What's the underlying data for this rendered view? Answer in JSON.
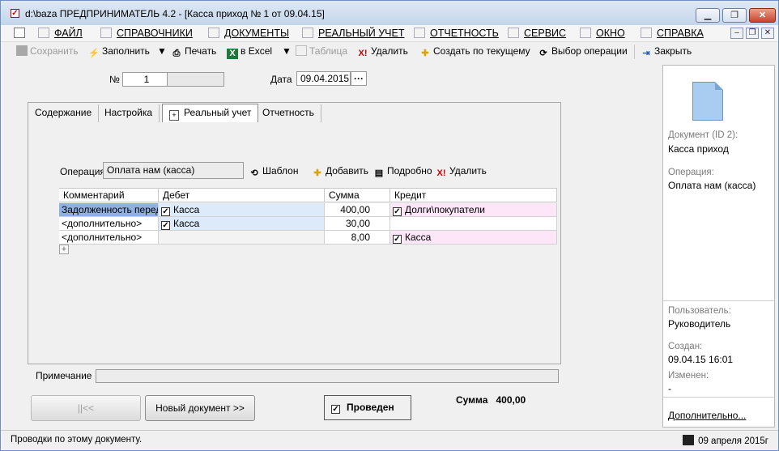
{
  "window": {
    "title": "d:\\baza  ПРЕДПРИНИМАТЕЛЬ 4.2 - [Касса приход № 1 от 09.04.15]"
  },
  "menu": {
    "items": [
      "ФАЙЛ",
      "СПРАВОЧНИКИ",
      "ДОКУМЕНТЫ",
      "РЕАЛЬНЫЙ УЧЕТ",
      "ОТЧЕТНОСТЬ",
      "СЕРВИС",
      "ОКНО",
      "СПРАВКА"
    ]
  },
  "toolbar": {
    "save": "Сохранить",
    "fill": "Заполнить",
    "print": "Печать",
    "excel": "в Excel",
    "table": "Таблица",
    "delete": "Удалить",
    "create_from": "Создать по текущему",
    "choose_operation": "Выбор операции",
    "close": "Закрыть"
  },
  "doc": {
    "number_label": "№",
    "number": "1",
    "date_label": "Дата",
    "date": "09.04.2015"
  },
  "tabs": [
    "Содержание",
    "Настройка",
    "Реальный учет",
    "Отчетность"
  ],
  "operation": {
    "label": "Операция",
    "value": "Оплата нам (касса)",
    "template": "Шаблон",
    "add": "Добавить",
    "details": "Подробно",
    "delete": "Удалить"
  },
  "grid": {
    "headers": [
      "Комментарий",
      "Дебет",
      "Сумма",
      "Кредит"
    ],
    "rows": [
      {
        "comment": "Задолженность перед",
        "debit": "Касса",
        "sum": "400,00",
        "credit": "Долги\\покупатели"
      },
      {
        "comment": "<дополнительно>",
        "debit": "Касса",
        "sum": "30,00",
        "credit": ""
      },
      {
        "comment": "<дополнительно>",
        "debit": "",
        "sum": "8,00",
        "credit": "Касса"
      }
    ]
  },
  "note_label": "Примечание",
  "buttons": {
    "prev": "||<<",
    "new_doc": "Новый документ >>",
    "posted": "Проведен"
  },
  "total": {
    "label": "Сумма",
    "value": "400,00"
  },
  "side": {
    "doc_label": "Документ  (ID 2):",
    "doc_value": "Касса приход",
    "op_label": "Операция:",
    "op_value": "Оплата нам (касса)",
    "user_label": "Пользователь:",
    "user_value": "Руководитель",
    "created_label": "Создан:",
    "created_value": "09.04.15  16:01",
    "changed_label": "Изменен:",
    "changed_value": "-",
    "more": "Дополнительно..."
  },
  "status": {
    "text": "Проводки по этому документу.",
    "date": "09 апреля 2015г"
  },
  "colors": {
    "debit_bg": "#ddeafa",
    "credit_bg": "#fde6f8",
    "selected_comment_bg": "#8fb1df"
  }
}
